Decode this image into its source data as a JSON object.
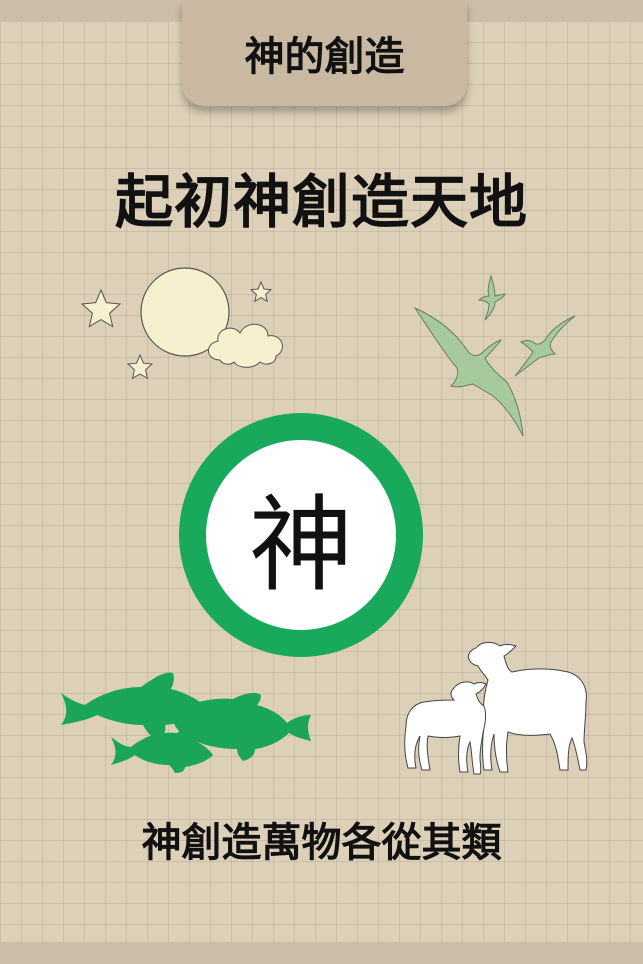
{
  "header": {
    "tab_label": "神的創造"
  },
  "headline": "起初神創造天地",
  "center": {
    "character": "神"
  },
  "caption": "神創造萬物各從其類",
  "illustrations": {
    "sky": {
      "icons": [
        "moon-icon",
        "star-icon",
        "cloud-icon"
      ]
    },
    "birds": {
      "icon": "bird-icon",
      "count": 3
    },
    "fish": {
      "icon": "fish-icon",
      "count": 3
    },
    "lambs": {
      "icon": "lamb-icon",
      "count": 2
    }
  },
  "colors": {
    "background": "#ddd0b8",
    "tab": "#c9b9a2",
    "ring_green": "#18a95c",
    "bird_green": "#a7c99e",
    "fish_green": "#1aa55a",
    "moon_cream": "#f6f0cf"
  }
}
